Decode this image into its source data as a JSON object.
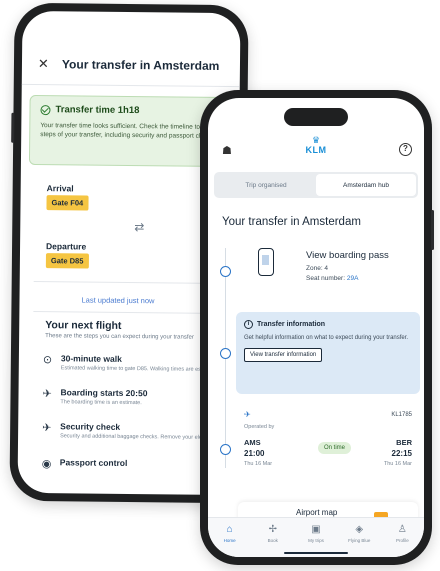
{
  "back_screen": {
    "title": "Your transfer in Amsterdam",
    "close_glyph": "✕",
    "banner": {
      "title": "Transfer time 1h18",
      "text": "Your transfer time looks sufficient. Check the timeline to see the steps of your transfer, including security and passport checks."
    },
    "arrival": {
      "label": "Arrival",
      "gate": "Gate F04"
    },
    "departure": {
      "label": "Departure",
      "gate": "Gate D85"
    },
    "swap_glyph": "⇄",
    "update_text": "Last updated just now",
    "next_flight": {
      "title": "Your next flight",
      "subtitle": "These are the steps you can expect during your transfer",
      "steps": [
        {
          "icon": "walk-icon",
          "glyph": "⊙",
          "title": "30-minute walk",
          "sub": "Estimated walking time to gate D85. Walking times are estimated."
        },
        {
          "icon": "boarding-icon",
          "glyph": "✈",
          "title": "Boarding starts 20:50",
          "sub": "The boarding time is an estimate."
        },
        {
          "icon": "security-icon",
          "glyph": "✈",
          "title": "Security check",
          "sub": "Security and additional baggage checks. Remove your electronics before."
        },
        {
          "icon": "passport-icon",
          "glyph": "◉",
          "title": "Passport control",
          "sub": ""
        }
      ]
    }
  },
  "front_screen": {
    "logo": {
      "crown": "♛",
      "word": "KLM"
    },
    "tabs": [
      {
        "label": "Trip organised",
        "active": false
      },
      {
        "label": "Amsterdam hub",
        "active": true
      }
    ],
    "title": "Your transfer in Amsterdam",
    "boarding_pass": {
      "title": "View boarding pass",
      "zone": "Zone: 4",
      "seat_label": "Seat number:",
      "seat": "29A"
    },
    "transfer_info": {
      "title": "Transfer information",
      "text": "Get helpful information on what to expect during your transfer.",
      "button": "View transfer information"
    },
    "flight": {
      "plane_glyph": "✈",
      "operator": "Operated by",
      "number": "KL1785",
      "status": "On time",
      "departure": {
        "code": "AMS",
        "time": "21:00",
        "date": "Thu 16 Mar"
      },
      "arrival": {
        "code": "BER",
        "time": "22:15",
        "date": "Thu 16 Mar"
      }
    },
    "airport_map": "Airport map",
    "nav": [
      {
        "icon": "home-icon",
        "glyph": "⌂",
        "label": "Home",
        "active": true
      },
      {
        "icon": "book-icon",
        "glyph": "✢",
        "label": "Book",
        "active": false
      },
      {
        "icon": "my-trips-icon",
        "glyph": "▣",
        "label": "My trips",
        "active": false
      },
      {
        "icon": "flying-blue-icon",
        "glyph": "◈",
        "label": "Flying Blue",
        "active": false
      },
      {
        "icon": "profile-icon",
        "glyph": "♙",
        "label": "Profile",
        "active": false
      }
    ]
  }
}
